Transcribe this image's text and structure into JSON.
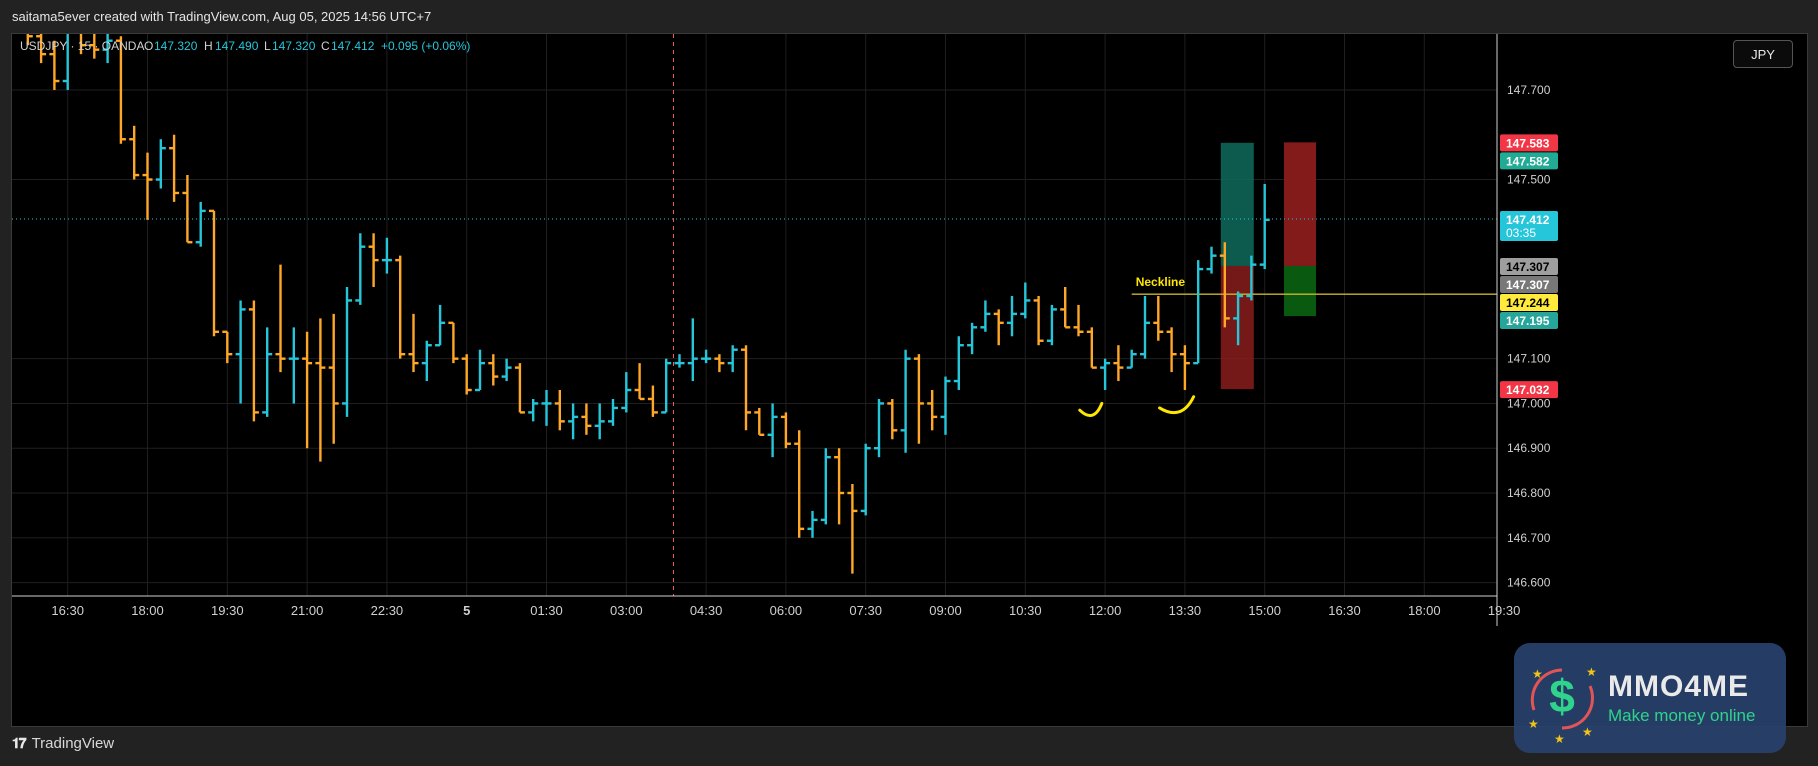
{
  "caption": "saitama5ever created with TradingView.com, Aug 05, 2025 14:56 UTC+7",
  "brand": "TradingView",
  "currency_button": "JPY",
  "watermark": {
    "name": "MMO4ME",
    "slogan": "Make money online"
  },
  "colors": {
    "bull": "#26c6da",
    "bear": "#ffa726",
    "grid": "#1f1f1f",
    "axis_text": "#d0d0d0",
    "neckline": "#c9b62a",
    "session_line": "#f05a5a",
    "target_zone": "#0e6b5c",
    "stop_zone": "#8a1c1c",
    "annotation": "#ffe600"
  },
  "chart_data": {
    "type": "ohlc",
    "symbol_line": {
      "symbol": "USDJPY · 15 · OANDA",
      "open_label": "O",
      "open": "147.320",
      "high_label": "H",
      "high": "147.490",
      "low_label": "L",
      "low": "147.320",
      "close_label": "C",
      "close": "147.412",
      "change": "+0.095 (+0.06%)"
    },
    "ylim": [
      146.57,
      147.825
    ],
    "y_ticks": [
      "147.700",
      "147.500",
      "147.100",
      "147.000",
      "146.900",
      "146.800",
      "146.700",
      "146.600"
    ],
    "x_ticks": [
      {
        "label": "16:30",
        "bar": 3
      },
      {
        "label": "18:00",
        "bar": 9
      },
      {
        "label": "19:30",
        "bar": 15
      },
      {
        "label": "21:00",
        "bar": 21
      },
      {
        "label": "22:30",
        "bar": 27
      },
      {
        "label": "5",
        "bar": 33
      },
      {
        "label": "01:30",
        "bar": 39
      },
      {
        "label": "03:00",
        "bar": 45
      },
      {
        "label": "04:30",
        "bar": 51
      },
      {
        "label": "06:00",
        "bar": 57
      },
      {
        "label": "07:30",
        "bar": 63
      },
      {
        "label": "09:00",
        "bar": 69
      },
      {
        "label": "10:30",
        "bar": 75
      },
      {
        "label": "12:00",
        "bar": 81
      },
      {
        "label": "13:30",
        "bar": 87
      },
      {
        "label": "15:00",
        "bar": 93
      },
      {
        "label": "16:30",
        "bar": 99
      },
      {
        "label": "18:00",
        "bar": 105
      },
      {
        "label": "19:30",
        "bar": 111
      }
    ],
    "session_break_bar": 49,
    "bars_ohlc": [
      [
        147.83,
        147.85,
        147.8,
        147.82
      ],
      [
        147.82,
        147.84,
        147.76,
        147.78
      ],
      [
        147.78,
        147.81,
        147.7,
        147.72
      ],
      [
        147.72,
        147.86,
        147.7,
        147.84
      ],
      [
        147.84,
        147.85,
        147.78,
        147.8
      ],
      [
        147.8,
        147.84,
        147.77,
        147.79
      ],
      [
        147.79,
        147.84,
        147.76,
        147.81
      ],
      [
        147.81,
        147.82,
        147.58,
        147.59
      ],
      [
        147.59,
        147.62,
        147.5,
        147.51
      ],
      [
        147.51,
        147.56,
        147.41,
        147.5
      ],
      [
        147.5,
        147.59,
        147.48,
        147.57
      ],
      [
        147.57,
        147.6,
        147.45,
        147.47
      ],
      [
        147.47,
        147.51,
        147.36,
        147.36
      ],
      [
        147.36,
        147.45,
        147.35,
        147.43
      ],
      [
        147.43,
        147.43,
        147.15,
        147.16
      ],
      [
        147.16,
        147.16,
        147.09,
        147.11
      ],
      [
        147.11,
        147.23,
        147.0,
        147.21
      ],
      [
        147.21,
        147.23,
        146.96,
        146.98
      ],
      [
        146.98,
        147.17,
        146.97,
        147.11
      ],
      [
        147.11,
        147.31,
        147.07,
        147.1
      ],
      [
        147.1,
        147.17,
        147.0,
        147.1
      ],
      [
        147.1,
        147.16,
        146.9,
        147.09
      ],
      [
        147.09,
        147.19,
        146.87,
        147.08
      ],
      [
        147.08,
        147.2,
        146.91,
        147.0
      ],
      [
        147.0,
        147.26,
        146.97,
        147.23
      ],
      [
        147.23,
        147.38,
        147.22,
        147.35
      ],
      [
        147.35,
        147.38,
        147.26,
        147.32
      ],
      [
        147.32,
        147.37,
        147.29,
        147.32
      ],
      [
        147.32,
        147.33,
        147.1,
        147.11
      ],
      [
        147.11,
        147.2,
        147.07,
        147.09
      ],
      [
        147.09,
        147.14,
        147.05,
        147.13
      ],
      [
        147.13,
        147.22,
        147.13,
        147.18
      ],
      [
        147.18,
        147.18,
        147.09,
        147.1
      ],
      [
        147.1,
        147.11,
        147.02,
        147.03
      ],
      [
        147.03,
        147.12,
        147.03,
        147.09
      ],
      [
        147.09,
        147.11,
        147.04,
        147.06
      ],
      [
        147.06,
        147.1,
        147.05,
        147.08
      ],
      [
        147.08,
        147.09,
        146.98,
        146.98
      ],
      [
        146.98,
        147.01,
        146.96,
        147.0
      ],
      [
        147.0,
        147.03,
        146.95,
        147.0
      ],
      [
        147.0,
        147.03,
        146.94,
        146.96
      ],
      [
        146.96,
        147.0,
        146.92,
        146.97
      ],
      [
        146.97,
        147.0,
        146.93,
        146.95
      ],
      [
        146.95,
        147.0,
        146.92,
        146.96
      ],
      [
        146.96,
        147.01,
        146.95,
        146.99
      ],
      [
        146.99,
        147.07,
        146.98,
        147.03
      ],
      [
        147.03,
        147.09,
        147.01,
        147.01
      ],
      [
        147.01,
        147.04,
        146.97,
        146.98
      ],
      [
        146.98,
        147.1,
        146.98,
        147.09
      ],
      [
        147.09,
        147.11,
        147.08,
        147.09
      ],
      [
        147.09,
        147.19,
        147.05,
        147.1
      ],
      [
        147.1,
        147.12,
        147.09,
        147.1
      ],
      [
        147.1,
        147.11,
        147.07,
        147.09
      ],
      [
        147.09,
        147.13,
        147.07,
        147.12
      ],
      [
        147.12,
        147.13,
        146.94,
        146.98
      ],
      [
        146.98,
        146.99,
        146.93,
        146.93
      ],
      [
        146.93,
        147.0,
        146.88,
        146.97
      ],
      [
        146.97,
        146.98,
        146.9,
        146.91
      ],
      [
        146.91,
        146.94,
        146.7,
        146.72
      ],
      [
        146.72,
        146.76,
        146.7,
        146.74
      ],
      [
        146.74,
        146.9,
        146.73,
        146.88
      ],
      [
        146.88,
        146.9,
        146.73,
        146.8
      ],
      [
        146.8,
        146.82,
        146.62,
        146.76
      ],
      [
        146.76,
        146.91,
        146.75,
        146.9
      ],
      [
        146.9,
        147.01,
        146.88,
        147.0
      ],
      [
        147.0,
        147.01,
        146.92,
        146.94
      ],
      [
        146.94,
        147.12,
        146.89,
        147.1
      ],
      [
        147.1,
        147.11,
        146.91,
        147.0
      ],
      [
        147.0,
        147.03,
        146.94,
        146.97
      ],
      [
        146.97,
        147.06,
        146.93,
        147.05
      ],
      [
        147.05,
        147.15,
        147.03,
        147.13
      ],
      [
        147.13,
        147.18,
        147.11,
        147.17
      ],
      [
        147.17,
        147.23,
        147.16,
        147.2
      ],
      [
        147.2,
        147.21,
        147.13,
        147.18
      ],
      [
        147.18,
        147.24,
        147.15,
        147.2
      ],
      [
        147.2,
        147.27,
        147.19,
        147.23
      ],
      [
        147.23,
        147.24,
        147.13,
        147.14
      ],
      [
        147.14,
        147.22,
        147.13,
        147.21
      ],
      [
        147.21,
        147.26,
        147.17,
        147.17
      ],
      [
        147.17,
        147.22,
        147.15,
        147.16
      ],
      [
        147.16,
        147.17,
        147.08,
        147.08
      ],
      [
        147.08,
        147.1,
        147.03,
        147.09
      ],
      [
        147.09,
        147.13,
        147.05,
        147.08
      ],
      [
        147.08,
        147.12,
        147.08,
        147.11
      ],
      [
        147.11,
        147.24,
        147.1,
        147.18
      ],
      [
        147.18,
        147.24,
        147.14,
        147.16
      ],
      [
        147.16,
        147.17,
        147.07,
        147.11
      ],
      [
        147.11,
        147.13,
        147.03,
        147.09
      ],
      [
        147.09,
        147.32,
        147.09,
        147.3
      ],
      [
        147.3,
        147.35,
        147.29,
        147.33
      ],
      [
        147.33,
        147.36,
        147.17,
        147.19
      ],
      [
        147.19,
        147.25,
        147.13,
        147.24
      ],
      [
        147.24,
        147.33,
        147.23,
        147.31
      ],
      [
        147.31,
        147.49,
        147.3,
        147.41
      ]
    ],
    "neckline": {
      "label": "Neckline",
      "price": 147.244
    },
    "long_position": {
      "entry": 147.307,
      "target": 147.582,
      "stop": 147.032
    },
    "short_position": {
      "entry": 147.307,
      "target": 147.195,
      "stop": 147.583
    },
    "price_labels": [
      {
        "text": "147.583",
        "price": 147.583,
        "bg": "#f23645",
        "fg": "#ffffff"
      },
      {
        "text": "147.582",
        "price": 147.582,
        "bg": "#22ab94",
        "fg": "#ffffff"
      },
      {
        "text": "147.412",
        "sub": "03:35",
        "price": 147.412,
        "bg": "#26c6da",
        "fg": "#ffffff"
      },
      {
        "text": "147.307",
        "price": 147.307,
        "bg": "#9e9e9e",
        "fg": "#000000"
      },
      {
        "text": "147.307",
        "price": 147.307,
        "bg": "#787878",
        "fg": "#ffffff"
      },
      {
        "text": "147.244",
        "price": 147.244,
        "bg": "#ffeb3b",
        "fg": "#000000"
      },
      {
        "text": "147.195",
        "price": 147.195,
        "bg": "#26a69a",
        "fg": "#ffffff"
      },
      {
        "text": "147.032",
        "price": 147.032,
        "bg": "#f23645",
        "fg": "#ffffff"
      }
    ]
  }
}
